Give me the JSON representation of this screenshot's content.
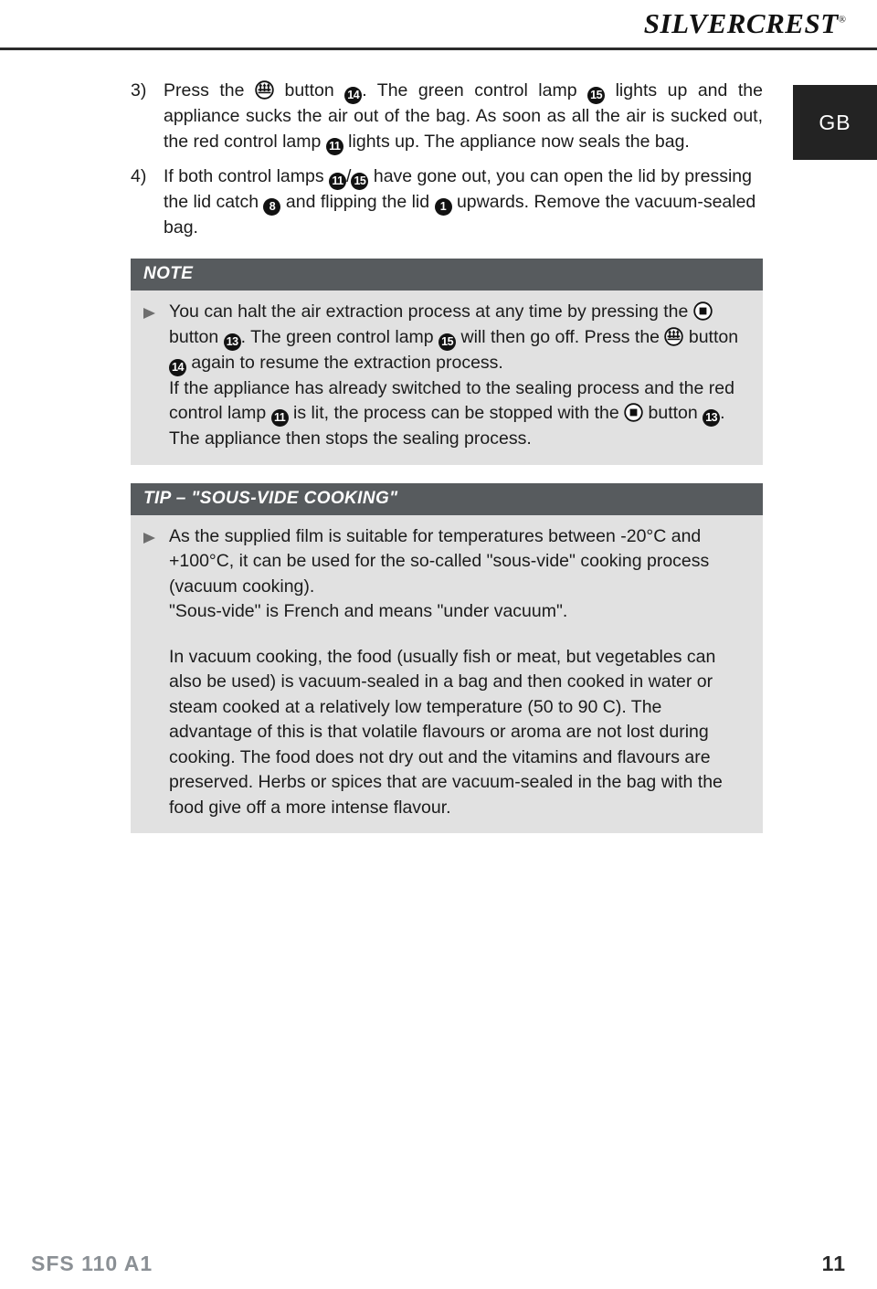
{
  "header": {
    "brand_first": "SILVER",
    "brand_second": "CREST",
    "registered_mark": "®"
  },
  "country_badge": {
    "label": "GB"
  },
  "steps": [
    {
      "number": "3)",
      "parts": [
        {
          "type": "text",
          "value": "Press the "
        },
        {
          "type": "icon",
          "value": "vacuum-icon"
        },
        {
          "type": "text",
          "value": " button "
        },
        {
          "type": "badge",
          "value": "14"
        },
        {
          "type": "text",
          "value": ". The green control lamp "
        },
        {
          "type": "badge",
          "value": "15"
        },
        {
          "type": "text",
          "value": " lights up and the appliance sucks the air out of the bag. As soon as all the air is sucked out, the red control lamp "
        },
        {
          "type": "badge",
          "value": "11"
        },
        {
          "type": "text",
          "value": " lights up. The appliance now seals the bag."
        }
      ]
    },
    {
      "number": "4)",
      "parts": [
        {
          "type": "text",
          "value": "If both control lamps "
        },
        {
          "type": "badge",
          "value": "11"
        },
        {
          "type": "text",
          "value": "/"
        },
        {
          "type": "badge",
          "value": "15"
        },
        {
          "type": "text",
          "value": " have gone out, you can open the lid by pressing the lid catch "
        },
        {
          "type": "badge",
          "value": "8"
        },
        {
          "type": "text",
          "value": " and flipping the lid "
        },
        {
          "type": "badge",
          "value": "1"
        },
        {
          "type": "text",
          "value": " upwards. Remove the vacuum-sealed bag."
        }
      ]
    }
  ],
  "note_box": {
    "title": "NOTE",
    "parts": [
      {
        "type": "text",
        "value": "You can halt the air extraction process at any time by pressing the "
      },
      {
        "type": "icon",
        "value": "stop-icon"
      },
      {
        "type": "text",
        "value": " button "
      },
      {
        "type": "badge",
        "value": "13"
      },
      {
        "type": "text",
        "value": ". The green control lamp "
      },
      {
        "type": "badge",
        "value": "15"
      },
      {
        "type": "text",
        "value": " will then go off. Press the "
      },
      {
        "type": "icon",
        "value": "vacuum-icon"
      },
      {
        "type": "text",
        "value": " button "
      },
      {
        "type": "badge",
        "value": "14"
      },
      {
        "type": "text",
        "value": " again to resume the extraction process."
      },
      {
        "type": "break",
        "value": ""
      },
      {
        "type": "text",
        "value": "If the appliance has already switched to the sealing process and the red control lamp "
      },
      {
        "type": "badge",
        "value": "11"
      },
      {
        "type": "text",
        "value": " is lit, the process can be stopped with the "
      },
      {
        "type": "icon",
        "value": "stop-icon"
      },
      {
        "type": "text",
        "value": " button "
      },
      {
        "type": "badge",
        "value": "13"
      },
      {
        "type": "text",
        "value": ". The appliance then stops the sealing process."
      }
    ]
  },
  "tip_box": {
    "title": "TIP – \"SOUS-VIDE COOKING\"",
    "parts": [
      {
        "type": "text",
        "value": "As the supplied film is suitable for temperatures between -20°C and +100°C, it can be used for the so-called \"sous-vide\" cooking process (vacuum cooking)."
      },
      {
        "type": "break",
        "value": ""
      },
      {
        "type": "text",
        "value": "\"Sous-vide\" is French and means \"under vacuum\"."
      }
    ],
    "paragraph": "In vacuum cooking, the food (usually fish or meat, but vegetables can also be used) is vacuum-sealed in a bag and then cooked in water or steam cooked at a relatively low temperature (50 to 90 C). The advantage of this is that volatile flavours or aroma are not lost during cooking. The food does not dry out and the vitamins and flavours are preserved. Herbs or spices that are vacuum-sealed in the bag with the food give off a more intense flavour."
  },
  "footer": {
    "model": "SFS 110 A1",
    "page_number": "11"
  },
  "colors": {
    "callout_header_bg": "#575b5e",
    "callout_body_bg": "#e1e1e1",
    "badge_bg": "#232323",
    "footer_model_color": "#8b9095",
    "rule_color": "#2b2b2b"
  }
}
